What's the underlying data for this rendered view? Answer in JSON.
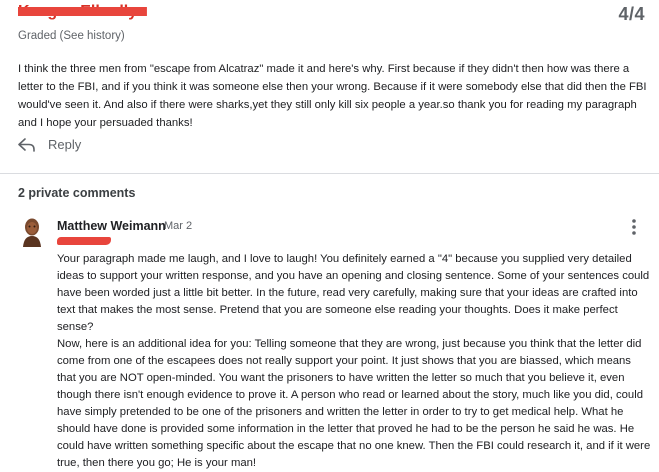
{
  "submission": {
    "student_name": "Keegan Ellonllyn",
    "grade": "4/4",
    "status": "Graded (See history)",
    "response_text": "I think the three men from \"escape from Alcatraz\" made it and here's why. First because if they didn't then how was there a letter to the FBI, and if you think it was someone else then your wrong. Because if it were somebody else that did then the FBI would've seen it. And also if there were sharks,yet they still only kill six people a year.so thank you for reading my paragraph and I hope your persuaded thanks!",
    "reply_label": "Reply"
  },
  "comments": {
    "count_label": "2 private comments",
    "items": [
      {
        "author": "Matthew Weimann",
        "date": "Mar 2",
        "text": "Your paragraph made me laugh, and I love to laugh! You definitely earned a \"4\" because you supplied very detailed ideas to support your written response, and you have an opening and closing sentence. Some of your sentences could have been worded just a little bit better. In the future, read very carefully, making sure that your ideas are crafted into text that makes the most sense. Pretend that you are someone else reading your thoughts. Does it make perfect sense?\nNow, here is an additional idea for you: Telling someone that they are wrong, just because you think that the letter did come from one of the escapees does not really support your point. It just shows that you are biassed, which means that you are NOT open-minded. You want the prisoners to have written the letter so much that you believe it, even though there isn't enough evidence to prove it. A person who read or learned about the story, much like you did, could have simply pretended to be one of the prisoners and written the letter in order to try to get medical help. What he should have done is provided some information in the letter that proved he had to be the person he said he was. He could have written something specific about the escape that no one knew. Then the FBI could research it, and if it were true, then there you go; He is your man!"
      }
    ]
  },
  "icons": {
    "reply": "reply-arrow-icon",
    "more": "more-vert-icon",
    "avatar": "avatar"
  },
  "colors": {
    "redaction": "#e8453c",
    "secondary_text": "#5f6368",
    "divider": "#dadce0"
  }
}
